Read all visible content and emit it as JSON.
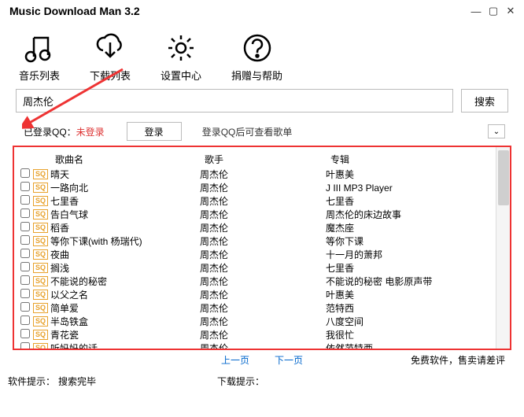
{
  "window": {
    "title": "Music Download Man 3.2"
  },
  "toolbar": {
    "items": [
      {
        "label": "音乐列表",
        "icon": "music-note-icon"
      },
      {
        "label": "下载列表",
        "icon": "download-cloud-icon"
      },
      {
        "label": "设置中心",
        "icon": "gear-icon"
      },
      {
        "label": "捐赠与帮助",
        "icon": "help-icon"
      }
    ]
  },
  "search": {
    "value": "周杰伦",
    "button": "搜索"
  },
  "login": {
    "label": "已登录QQ：",
    "status": "未登录",
    "button": "登录",
    "hint": "登录QQ后可查看歌单"
  },
  "table": {
    "headers": {
      "name": "歌曲名",
      "artist": "歌手",
      "album": "专辑"
    },
    "rows": [
      {
        "name": "晴天",
        "artist": "周杰伦",
        "album": "叶惠美"
      },
      {
        "name": "一路向北",
        "artist": "周杰伦",
        "album": "J III MP3 Player"
      },
      {
        "name": "七里香",
        "artist": "周杰伦",
        "album": "七里香"
      },
      {
        "name": "告白气球",
        "artist": "周杰伦",
        "album": "周杰伦的床边故事"
      },
      {
        "name": "稻香",
        "artist": "周杰伦",
        "album": "魔杰座"
      },
      {
        "name": "等你下课(with 杨瑞代)",
        "artist": "周杰伦",
        "album": "等你下课"
      },
      {
        "name": "夜曲",
        "artist": "周杰伦",
        "album": "十一月的萧邦"
      },
      {
        "name": "搁浅",
        "artist": "周杰伦",
        "album": "七里香"
      },
      {
        "name": "不能说的秘密",
        "artist": "周杰伦",
        "album": "不能说的秘密 电影原声带"
      },
      {
        "name": "以父之名",
        "artist": "周杰伦",
        "album": "叶惠美"
      },
      {
        "name": "简单爱",
        "artist": "周杰伦",
        "album": "范特西"
      },
      {
        "name": "半岛铁盒",
        "artist": "周杰伦",
        "album": "八度空间"
      },
      {
        "name": "青花瓷",
        "artist": "周杰伦",
        "album": "我很忙"
      },
      {
        "name": "听妈妈的话",
        "artist": "周杰伦",
        "album": "依然范特西"
      }
    ]
  },
  "pager": {
    "prev": "上一页",
    "next": "下一页",
    "note": "免费软件，售卖请差评"
  },
  "footer": {
    "soft_label": "软件提示：",
    "soft_value": "搜索完毕",
    "dl_label": "下载提示："
  },
  "colors": {
    "highlight_border": "#e33",
    "sq_badge": "#e8a22c",
    "arrow": "#e33",
    "link": "#0066cc"
  }
}
